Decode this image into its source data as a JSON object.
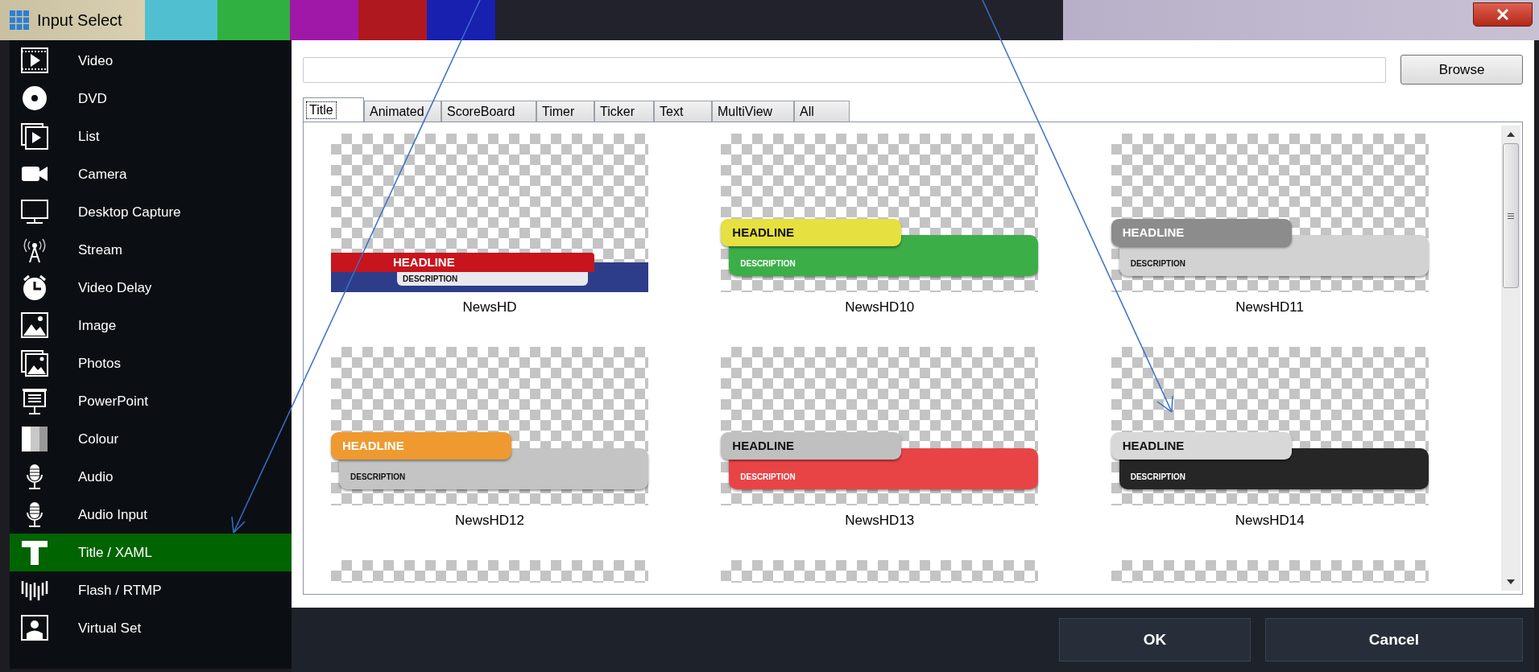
{
  "window": {
    "title": "Input Select"
  },
  "sidebar": {
    "items": [
      {
        "kind": "video",
        "label": "Video",
        "selected": false
      },
      {
        "kind": "dvd",
        "label": "DVD",
        "selected": false
      },
      {
        "kind": "list",
        "label": "List",
        "selected": false
      },
      {
        "kind": "camera",
        "label": "Camera",
        "selected": false
      },
      {
        "kind": "desktop",
        "label": "Desktop Capture",
        "selected": false
      },
      {
        "kind": "stream",
        "label": "Stream",
        "selected": false
      },
      {
        "kind": "delay",
        "label": "Video Delay",
        "selected": false
      },
      {
        "kind": "image",
        "label": "Image",
        "selected": false
      },
      {
        "kind": "photos",
        "label": "Photos",
        "selected": false
      },
      {
        "kind": "powerpoint",
        "label": "PowerPoint",
        "selected": false
      },
      {
        "kind": "colour",
        "label": "Colour",
        "selected": false
      },
      {
        "kind": "audio",
        "label": "Audio",
        "selected": false
      },
      {
        "kind": "audio",
        "label": "Audio Input",
        "selected": false
      },
      {
        "kind": "title",
        "label": "Title / XAML",
        "selected": true
      },
      {
        "kind": "flash",
        "label": "Flash / RTMP",
        "selected": false
      },
      {
        "kind": "virtualset",
        "label": "Virtual Set",
        "selected": false
      }
    ]
  },
  "browse_button": "Browse",
  "tabs": [
    {
      "label": "Title",
      "selected": true
    },
    {
      "label": "Animated",
      "selected": false
    },
    {
      "label": "ScoreBoard",
      "selected": false
    },
    {
      "label": "Timer",
      "selected": false
    },
    {
      "label": "Ticker",
      "selected": false
    },
    {
      "label": "Text",
      "selected": false
    },
    {
      "label": "MultiView",
      "selected": false
    },
    {
      "label": "All",
      "selected": false
    }
  ],
  "templates": [
    {
      "kind": "flat",
      "name": "NewsHD",
      "headline": {
        "text": "HEADLINE",
        "color": "#c8141c"
      },
      "description": {
        "text": "DESCRIPTION",
        "color": "#e8e8ee"
      },
      "band": {
        "color": "#2d3d8a"
      }
    },
    {
      "kind": "rounded",
      "name": "NewsHD10",
      "headline": {
        "text": "HEADLINE",
        "color": "#e6e040"
      },
      "description": {
        "text": "DESCRIPTION",
        "color": "#3cae48"
      }
    },
    {
      "kind": "rounded",
      "name": "NewsHD11",
      "headline": {
        "text": "HEADLINE",
        "color": "#8c8c8c"
      },
      "description": {
        "text": "DESCRIPTION",
        "color": "#d2d2d2"
      }
    },
    {
      "kind": "rounded",
      "name": "NewsHD12",
      "headline": {
        "text": "HEADLINE",
        "color": "#ee9a30"
      },
      "description": {
        "text": "DESCRIPTION",
        "color": "#c4c4c4"
      }
    },
    {
      "kind": "rounded",
      "name": "NewsHD13",
      "headline": {
        "text": "HEADLINE",
        "color": "#c0c0c0"
      },
      "description": {
        "text": "DESCRIPTION",
        "color": "#e84446"
      }
    },
    {
      "kind": "rounded",
      "name": "NewsHD14",
      "headline": {
        "text": "HEADLINE",
        "color": "#d8d8d8"
      },
      "description": {
        "text": "DESCRIPTION",
        "color": "#262626"
      }
    },
    {
      "kind": "partial"
    },
    {
      "kind": "partial"
    },
    {
      "kind": "partial"
    }
  ],
  "buttons": [
    {
      "label": "OK"
    },
    {
      "label": "Cancel"
    }
  ]
}
